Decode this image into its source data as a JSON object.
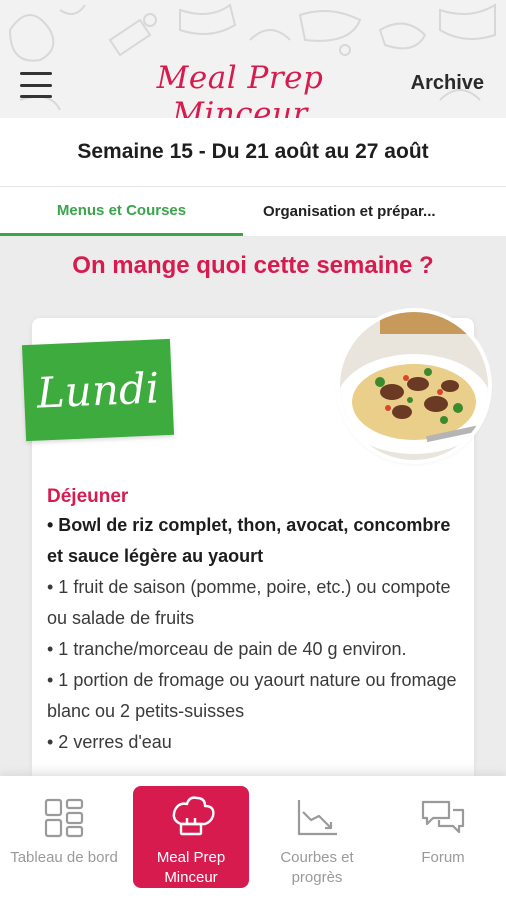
{
  "header": {
    "brand": "Meal Prep Minceur",
    "archive_label": "Archive"
  },
  "week": {
    "title": "Semaine 15 - Du 21 août au 27 août"
  },
  "tabs": [
    {
      "label": "Menus et Courses",
      "active": true
    },
    {
      "label": "Organisation et prépar...",
      "active": false
    }
  ],
  "section_title": "On mange quoi cette semaine ?",
  "card": {
    "day": "Lundi",
    "meal_title": "Déjeuner",
    "main_item": "• Bowl de riz complet, thon, avocat, concombre et sauce légère au yaourt",
    "items": [
      "• 1 fruit de saison (pomme, poire, etc.) ou compote ou salade de fruits",
      "• 1 tranche/morceau de pain de 40 g environ.",
      "• 1 portion de fromage ou yaourt nature ou fromage blanc ou 2 petits-suisses",
      "• 2 verres d'eau"
    ]
  },
  "bottom_nav": [
    {
      "label": "Tableau de bord",
      "icon": "dashboard-icon",
      "active": false
    },
    {
      "label": "Meal Prep Minceur",
      "icon": "chef-hat-icon",
      "active": true
    },
    {
      "label": "Courbes et progrès",
      "icon": "chart-icon",
      "active": false
    },
    {
      "label": "Forum",
      "icon": "chat-icon",
      "active": false
    }
  ],
  "colors": {
    "brand": "#d81b4f",
    "accent_green": "#3aa54a",
    "background": "#ececec"
  }
}
